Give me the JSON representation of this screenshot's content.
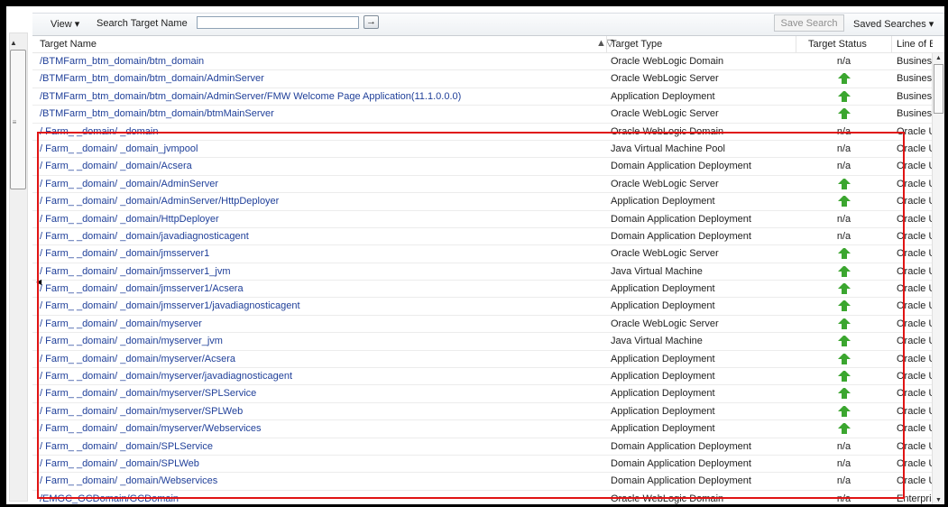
{
  "toolbar": {
    "view_label": "View ▾",
    "search_label": "Search Target Name",
    "search_value": "",
    "go_icon": "→",
    "save_search_label": "Save Search",
    "saved_searches_label": "Saved Searches ▾"
  },
  "table": {
    "headers": [
      "Target Name",
      "Target Type",
      "Target Status",
      "Line of Bi"
    ],
    "sort_indicator": "▲▽",
    "rows": [
      {
        "name": "/BTMFarm_btm_domain/btm_domain",
        "type": "Oracle WebLogic Domain",
        "status": "n/a",
        "lob": "Business"
      },
      {
        "name": "/BTMFarm_btm_domain/btm_domain/AdminServer",
        "type": "Oracle WebLogic Server",
        "status": "up",
        "lob": "Business"
      },
      {
        "name": "/BTMFarm_btm_domain/btm_domain/AdminServer/FMW Welcome Page Application(11.1.0.0.0)",
        "type": "Application Deployment",
        "status": "up",
        "lob": "Business"
      },
      {
        "name": "/BTMFarm_btm_domain/btm_domain/btmMainServer",
        "type": "Oracle WebLogic Server",
        "status": "up",
        "lob": "Business"
      },
      {
        "name": "/       Farm_     _domain/     _domain",
        "type": "Oracle WebLogic Domain",
        "status": "n/a",
        "lob": "Oracle U"
      },
      {
        "name": "/       Farm_     _domain/     _domain_jvmpool",
        "type": "Java Virtual Machine Pool",
        "status": "n/a",
        "lob": "Oracle U"
      },
      {
        "name": "/       Farm_     _domain/     _domain/Acsera",
        "type": "Domain Application Deployment",
        "status": "n/a",
        "lob": "Oracle U"
      },
      {
        "name": "/       Farm_     _domain/     _domain/AdminServer",
        "type": "Oracle WebLogic Server",
        "status": "up",
        "lob": "Oracle U"
      },
      {
        "name": "/       Farm_     _domain/     _domain/AdminServer/HttpDeployer",
        "type": "Application Deployment",
        "status": "up",
        "lob": "Oracle U"
      },
      {
        "name": "/       Farm_     _domain/     _domain/HttpDeployer",
        "type": "Domain Application Deployment",
        "status": "n/a",
        "lob": "Oracle U"
      },
      {
        "name": "/       Farm_     _domain/     _domain/javadiagnosticagent",
        "type": "Domain Application Deployment",
        "status": "n/a",
        "lob": "Oracle U"
      },
      {
        "name": "/       Farm_     _domain/     _domain/jmsserver1",
        "type": "Oracle WebLogic Server",
        "status": "up",
        "lob": "Oracle U"
      },
      {
        "name": "/       Farm_     _domain/     _domain/jmsserver1_jvm",
        "type": "Java Virtual Machine",
        "status": "up",
        "lob": "Oracle U"
      },
      {
        "name": "/       Farm_     _domain/     _domain/jmsserver1/Acsera",
        "type": "Application Deployment",
        "status": "up",
        "lob": "Oracle U"
      },
      {
        "name": "/       Farm_     _domain/     _domain/jmsserver1/javadiagnosticagent",
        "type": "Application Deployment",
        "status": "up",
        "lob": "Oracle U"
      },
      {
        "name": "/       Farm_     _domain/     _domain/myserver",
        "type": "Oracle WebLogic Server",
        "status": "up",
        "lob": "Oracle U"
      },
      {
        "name": "/       Farm_     _domain/     _domain/myserver_jvm",
        "type": "Java Virtual Machine",
        "status": "up",
        "lob": "Oracle U"
      },
      {
        "name": "/       Farm_     _domain/     _domain/myserver/Acsera",
        "type": "Application Deployment",
        "status": "up",
        "lob": "Oracle U"
      },
      {
        "name": "/       Farm_     _domain/     _domain/myserver/javadiagnosticagent",
        "type": "Application Deployment",
        "status": "up",
        "lob": "Oracle U"
      },
      {
        "name": "/       Farm_     _domain/     _domain/myserver/SPLService",
        "type": "Application Deployment",
        "status": "up",
        "lob": "Oracle U"
      },
      {
        "name": "/       Farm_     _domain/     _domain/myserver/SPLWeb",
        "type": "Application Deployment",
        "status": "up",
        "lob": "Oracle U"
      },
      {
        "name": "/       Farm_     _domain/     _domain/myserver/Webservices",
        "type": "Application Deployment",
        "status": "up",
        "lob": "Oracle U"
      },
      {
        "name": "/       Farm_     _domain/     _domain/SPLService",
        "type": "Domain Application Deployment",
        "status": "n/a",
        "lob": "Oracle U"
      },
      {
        "name": "/       Farm_     _domain/     _domain/SPLWeb",
        "type": "Domain Application Deployment",
        "status": "n/a",
        "lob": "Oracle U"
      },
      {
        "name": "/       Farm_     _domain/     _domain/Webservices",
        "type": "Domain Application Deployment",
        "status": "n/a",
        "lob": "Oracle U"
      },
      {
        "name": "/EMGC_GCDomain/GCDomain",
        "type": "Oracle WebLogic Domain",
        "status": "n/a",
        "lob": "Enterpris"
      }
    ]
  },
  "icons": {
    "status_up": "up-arrow-icon",
    "status_up_color": "#3ba62f",
    "highlight_color": "#e01414"
  }
}
